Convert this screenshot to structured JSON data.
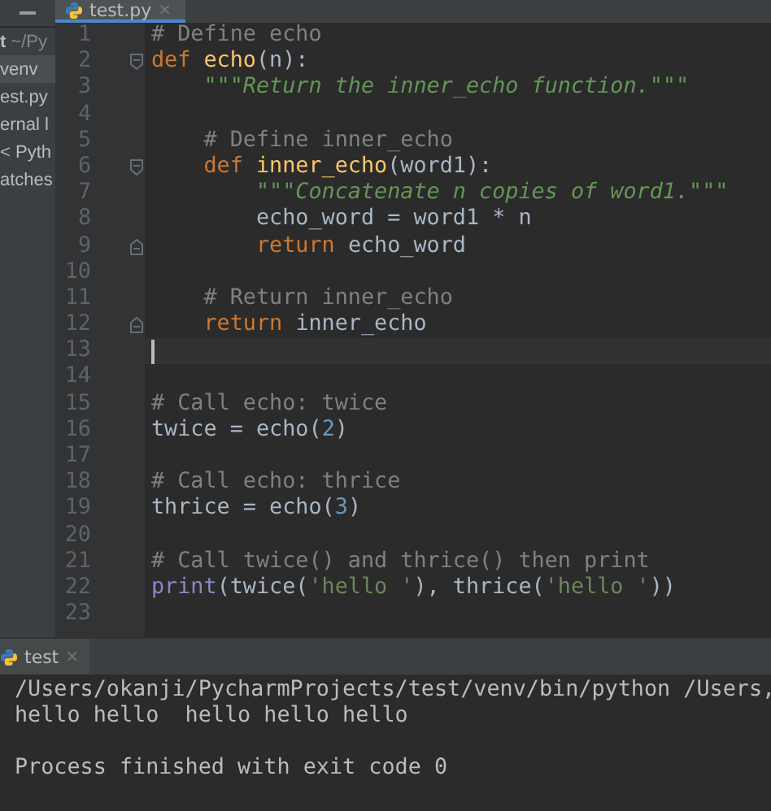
{
  "sidebar": {
    "items": [
      {
        "label": "t",
        "path": "~/Py",
        "selected": false
      },
      {
        "label": "venv",
        "selected": true
      },
      {
        "label": "est.py",
        "selected": false
      },
      {
        "label": "ernal l",
        "selected": false
      },
      {
        "label": "< Pyth",
        "selected": false
      },
      {
        "label": "atches",
        "selected": false
      }
    ]
  },
  "editor": {
    "tab": {
      "label": "test.py",
      "close": "×",
      "selected": true
    },
    "lines": [
      {
        "number": "1",
        "current": false,
        "fold_start": false,
        "fold_end": false,
        "tokens": [
          {
            "kind": "comment",
            "text": "# Define echo"
          }
        ]
      },
      {
        "number": "2",
        "current": false,
        "fold_start": true,
        "fold_end": false,
        "tokens": [
          {
            "kind": "keyword",
            "text": "def "
          },
          {
            "kind": "function",
            "text": "echo"
          },
          {
            "kind": "plain",
            "text": "(n):"
          }
        ]
      },
      {
        "number": "3",
        "current": false,
        "fold_start": false,
        "fold_end": false,
        "tokens": [
          {
            "kind": "docstring",
            "text": "    \"\"\"Return the inner_echo function.\"\"\""
          }
        ]
      },
      {
        "number": "4",
        "current": false,
        "fold_start": false,
        "fold_end": false
      },
      {
        "number": "5",
        "current": false,
        "fold_start": false,
        "fold_end": false,
        "tokens": [
          {
            "kind": "comment",
            "text": "    # Define inner_echo"
          }
        ]
      },
      {
        "number": "6",
        "current": false,
        "fold_start": true,
        "fold_end": false,
        "tokens": [
          {
            "kind": "keyword",
            "text": "    def "
          },
          {
            "kind": "function",
            "text": "inner_echo"
          },
          {
            "kind": "plain",
            "text": "(word1):"
          }
        ]
      },
      {
        "number": "7",
        "current": false,
        "fold_start": false,
        "fold_end": false,
        "tokens": [
          {
            "kind": "docstring",
            "text": "        \"\"\"Concatenate n copies of word1.\"\"\""
          }
        ]
      },
      {
        "number": "8",
        "current": false,
        "fold_start": false,
        "fold_end": false,
        "tokens": [
          {
            "kind": "plain",
            "text": "        echo_word = word1 * n"
          }
        ]
      },
      {
        "number": "9",
        "current": false,
        "fold_start": false,
        "fold_end": true,
        "tokens": [
          {
            "kind": "keyword",
            "text": "        return "
          },
          {
            "kind": "plain",
            "text": "echo_word"
          }
        ]
      },
      {
        "number": "10",
        "current": false,
        "fold_start": false,
        "fold_end": false
      },
      {
        "number": "11",
        "current": false,
        "fold_start": false,
        "fold_end": false,
        "tokens": [
          {
            "kind": "comment",
            "text": "    # Return inner_echo"
          }
        ]
      },
      {
        "number": "12",
        "current": false,
        "fold_start": false,
        "fold_end": true,
        "tokens": [
          {
            "kind": "keyword",
            "text": "    return "
          },
          {
            "kind": "plain",
            "text": "inner_echo"
          }
        ]
      },
      {
        "number": "13",
        "current": true,
        "fold_start": false,
        "fold_end": false
      },
      {
        "number": "14",
        "current": false,
        "fold_start": false,
        "fold_end": false
      },
      {
        "number": "15",
        "current": false,
        "fold_start": false,
        "fold_end": false,
        "tokens": [
          {
            "kind": "comment",
            "text": "# Call echo: twice"
          }
        ]
      },
      {
        "number": "16",
        "current": false,
        "fold_start": false,
        "fold_end": false,
        "tokens": [
          {
            "kind": "plain",
            "text": "twice = echo("
          },
          {
            "kind": "number",
            "text": "2"
          },
          {
            "kind": "plain",
            "text": ")"
          }
        ]
      },
      {
        "number": "17",
        "current": false,
        "fold_start": false,
        "fold_end": false
      },
      {
        "number": "18",
        "current": false,
        "fold_start": false,
        "fold_end": false,
        "tokens": [
          {
            "kind": "comment",
            "text": "# Call echo: thrice"
          }
        ]
      },
      {
        "number": "19",
        "current": false,
        "fold_start": false,
        "fold_end": false,
        "tokens": [
          {
            "kind": "plain",
            "text": "thrice = echo("
          },
          {
            "kind": "number",
            "text": "3"
          },
          {
            "kind": "plain",
            "text": ")"
          }
        ]
      },
      {
        "number": "20",
        "current": false,
        "fold_start": false,
        "fold_end": false
      },
      {
        "number": "21",
        "current": false,
        "fold_start": false,
        "fold_end": false,
        "tokens": [
          {
            "kind": "comment",
            "text": "# Call twice() and thrice() then print"
          }
        ]
      },
      {
        "number": "22",
        "current": false,
        "fold_start": false,
        "fold_end": false,
        "tokens": [
          {
            "kind": "builtin",
            "text": "print"
          },
          {
            "kind": "plain",
            "text": "(twice("
          },
          {
            "kind": "string",
            "text": "'hello '"
          },
          {
            "kind": "plain",
            "text": "), thrice("
          },
          {
            "kind": "string",
            "text": "'hello '"
          },
          {
            "kind": "plain",
            "text": "))"
          }
        ]
      },
      {
        "number": "23",
        "current": false,
        "fold_start": false,
        "fold_end": false
      }
    ]
  },
  "run_panel": {
    "tab": {
      "label": "test",
      "close": "×",
      "selected": true
    },
    "output_blocks": [
      [
        "/Users/okanji/PycharmProjects/test/venv/bin/python /Users,",
        "hello hello  hello hello hello"
      ],
      [
        "Process finished with exit code 0"
      ]
    ]
  }
}
